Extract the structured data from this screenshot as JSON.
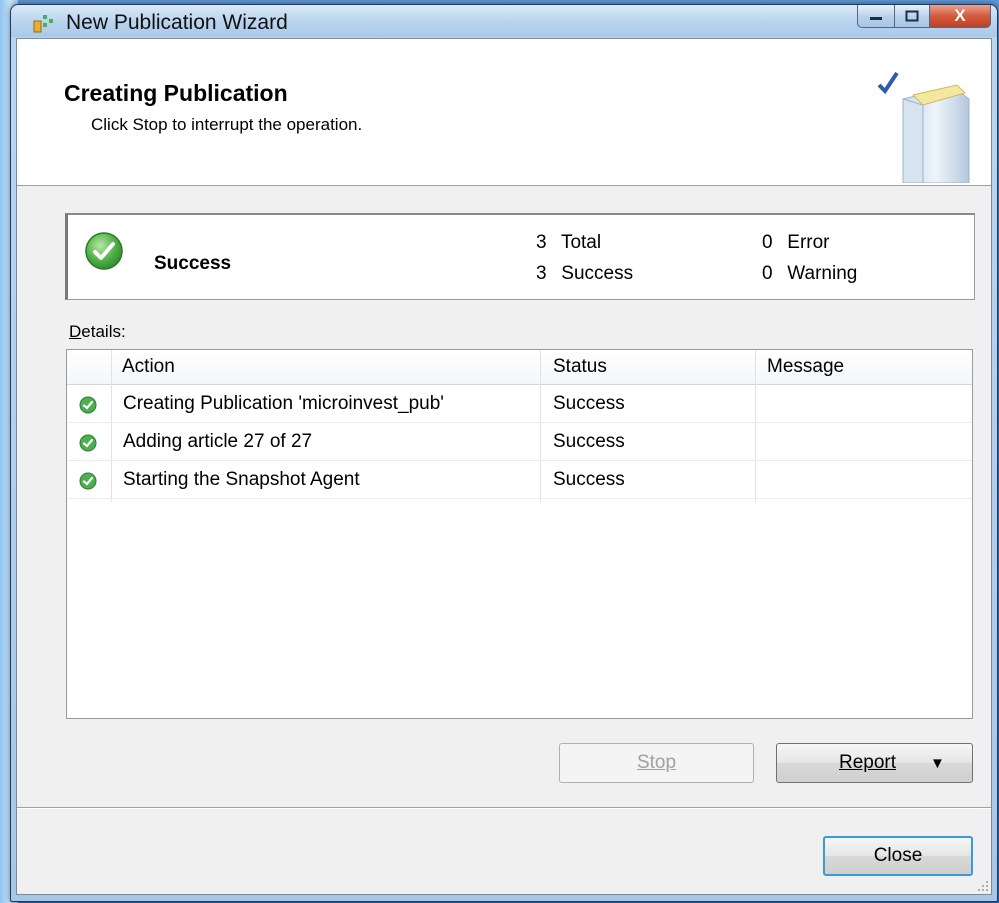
{
  "window": {
    "title": "New Publication Wizard",
    "minimize_label": "–",
    "maximize_label": "□",
    "close_label": "X"
  },
  "header": {
    "title": "Creating Publication",
    "subtitle": "Click Stop to interrupt the operation."
  },
  "summary": {
    "status": "Success",
    "total_count": "3",
    "total_label": "Total",
    "success_count": "3",
    "success_label": "Success",
    "error_count": "0",
    "error_label": "Error",
    "warning_count": "0",
    "warning_label": "Warning"
  },
  "details": {
    "label_accel": "D",
    "label_rest": "etails:",
    "columns": [
      "Action",
      "Status",
      "Message"
    ],
    "rows": [
      {
        "action": "Creating Publication 'microinvest_pub'",
        "status": "Success",
        "message": ""
      },
      {
        "action": "Adding article 27 of 27",
        "status": "Success",
        "message": ""
      },
      {
        "action": "Starting the Snapshot Agent",
        "status": "Success",
        "message": ""
      }
    ]
  },
  "buttons": {
    "stop": "Stop",
    "report": "Report",
    "report_arrow": "▼",
    "close": "Close"
  },
  "colors": {
    "success_green": "#3fa53a",
    "focus_border": "#3c9ad8"
  }
}
